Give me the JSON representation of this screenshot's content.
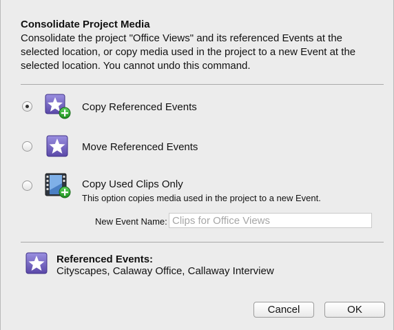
{
  "dialog": {
    "title": "Consolidate Project Media",
    "description": "Consolidate the project \"Office Views\" and its referenced Events at the selected location, or copy media used in the project to a new Event at the selected location. You cannot undo this command."
  },
  "options": [
    {
      "label": "Copy Referenced Events",
      "selected": true,
      "icon": "star-plus-icon"
    },
    {
      "label": "Move Referenced Events",
      "selected": false,
      "icon": "star-icon"
    },
    {
      "label": "Copy Used Clips Only",
      "note": "This option copies media used in the project to a new Event.",
      "selected": false,
      "icon": "film-clip-plus-icon"
    }
  ],
  "new_event": {
    "label": "New Event Name:",
    "placeholder": "Clips for Office Views",
    "value": ""
  },
  "referenced_events": {
    "title": "Referenced Events:",
    "list": "Cityscapes, Calaway Office, Callaway Interview",
    "icon": "star-icon"
  },
  "buttons": {
    "cancel": "Cancel",
    "ok": "OK"
  },
  "colors": {
    "dialog_bg": "#ececec",
    "separator": "#a9a9a9",
    "event_icon_purple": "#6b5bb5",
    "plus_badge_green": "#2ea32e"
  }
}
